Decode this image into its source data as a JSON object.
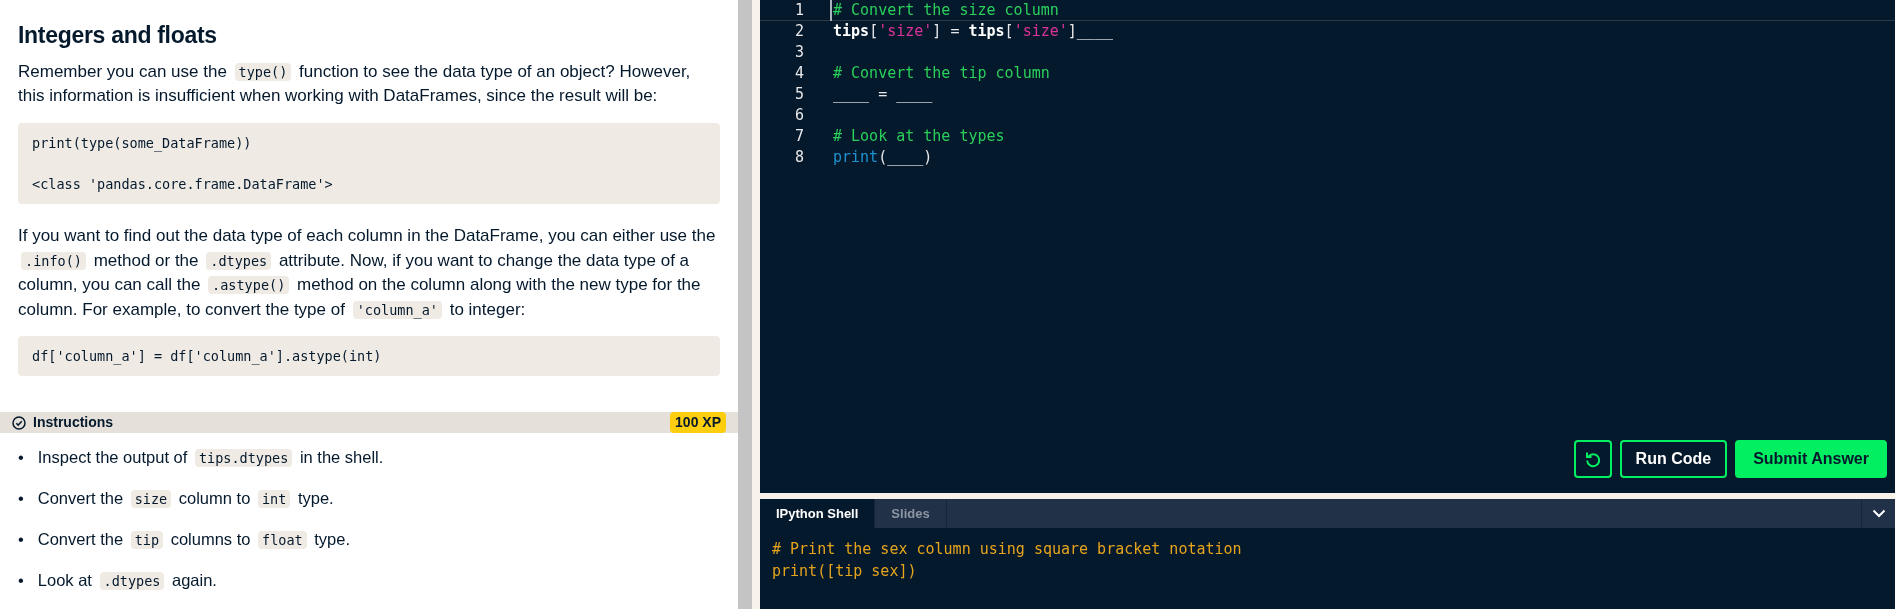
{
  "lesson": {
    "title": "Integers and floats",
    "content": [
      {
        "kind": "paragraph",
        "segments": [
          {
            "kind": "text",
            "text": "Remember you can use the "
          },
          {
            "kind": "code",
            "text": "type()"
          },
          {
            "kind": "text",
            "text": " function to see the data type of an object? However, this information is insufficient when working with DataFrames, since the result will be:"
          }
        ]
      },
      {
        "kind": "code_block",
        "lines": [
          "print(type(some_DataFrame))",
          "<class 'pandas.core.frame.DataFrame'>"
        ]
      },
      {
        "kind": "paragraph",
        "segments": [
          {
            "kind": "text",
            "text": "If you want to find out the data type of each column in the DataFrame, you can either use the "
          },
          {
            "kind": "code",
            "text": ".info()"
          },
          {
            "kind": "text",
            "text": " method or the "
          },
          {
            "kind": "code",
            "text": ".dtypes"
          },
          {
            "kind": "text",
            "text": " attribute. Now, if you want to change the data type of a column, you can call the "
          },
          {
            "kind": "code",
            "text": ".astype()"
          },
          {
            "kind": "text",
            "text": " method on the column along with the new type for the column. For example, to convert the type of "
          },
          {
            "kind": "code",
            "text": "'column_a'"
          },
          {
            "kind": "text",
            "text": " to integer:"
          }
        ]
      },
      {
        "kind": "code_block",
        "lines": [
          "df['column_a'] = df['column_a'].astype(int)"
        ]
      }
    ]
  },
  "instructions": {
    "title": "Instructions",
    "xp": "100 XP",
    "items": [
      {
        "bullet": "•",
        "segments": [
          {
            "kind": "text",
            "text": "Inspect the output of "
          },
          {
            "kind": "code",
            "text": "tips.dtypes"
          },
          {
            "kind": "text",
            "text": " in the shell."
          }
        ]
      },
      {
        "bullet": "•",
        "segments": [
          {
            "kind": "text",
            "text": "Convert the "
          },
          {
            "kind": "code",
            "text": "size"
          },
          {
            "kind": "text",
            "text": " column to "
          },
          {
            "kind": "code",
            "text": "int"
          },
          {
            "kind": "text",
            "text": " type."
          }
        ]
      },
      {
        "bullet": "•",
        "segments": [
          {
            "kind": "text",
            "text": "Convert the "
          },
          {
            "kind": "code",
            "text": "tip"
          },
          {
            "kind": "text",
            "text": " columns to "
          },
          {
            "kind": "code",
            "text": "float"
          },
          {
            "kind": "text",
            "text": " type."
          }
        ]
      },
      {
        "bullet": "•",
        "segments": [
          {
            "kind": "text",
            "text": "Look at "
          },
          {
            "kind": "code",
            "text": ".dtypes"
          },
          {
            "kind": "text",
            "text": " again."
          }
        ]
      }
    ]
  },
  "editor": {
    "lines": [
      {
        "number": "1",
        "current": true,
        "tokens": [
          {
            "kind": "comment",
            "text": "# Convert the size column"
          }
        ]
      },
      {
        "number": "2",
        "current": false,
        "tokens": [
          {
            "kind": "identifier",
            "text": "tips"
          },
          {
            "kind": "punct",
            "text": "["
          },
          {
            "kind": "string",
            "text": "'size'"
          },
          {
            "kind": "punct",
            "text": "] = "
          },
          {
            "kind": "identifier",
            "text": "tips"
          },
          {
            "kind": "punct",
            "text": "["
          },
          {
            "kind": "string",
            "text": "'size'"
          },
          {
            "kind": "punct",
            "text": "]____"
          }
        ]
      },
      {
        "number": "3",
        "current": false
      },
      {
        "number": "4",
        "current": false,
        "tokens": [
          {
            "kind": "comment",
            "text": "# Convert the tip column"
          }
        ]
      },
      {
        "number": "5",
        "current": false,
        "tokens": [
          {
            "kind": "punct",
            "text": "____ = ____"
          }
        ]
      },
      {
        "number": "6",
        "current": false
      },
      {
        "number": "7",
        "current": false,
        "tokens": [
          {
            "kind": "comment",
            "text": "# Look at the types"
          }
        ]
      },
      {
        "number": "8",
        "current": false,
        "tokens": [
          {
            "kind": "builtin",
            "text": "print"
          },
          {
            "kind": "punct",
            "text": "(____)"
          }
        ]
      }
    ],
    "buttons": [
      {
        "kind": "reset"
      },
      {
        "kind": "run",
        "label": "Run Code"
      },
      {
        "kind": "submit",
        "label": "Submit Answer"
      }
    ]
  },
  "shell": {
    "tabs": [
      {
        "label": "IPython Shell",
        "selected": true
      },
      {
        "label": "Slides",
        "selected": false
      }
    ],
    "lines": [
      "# Print the sex column using square bracket notation",
      "print([tip sex])"
    ]
  }
}
